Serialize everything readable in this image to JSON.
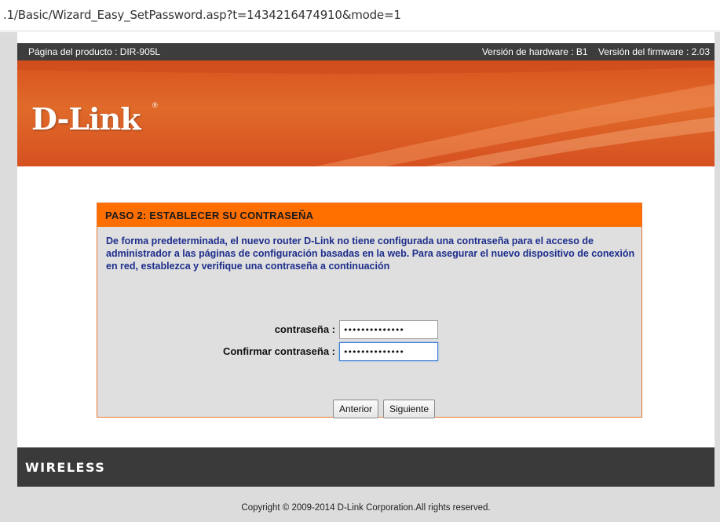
{
  "browser": {
    "url": ".1/Basic/Wizard_Easy_SetPassword.asp?t=1434216474910&mode=1"
  },
  "topbar": {
    "product_page": "Página del producto : DIR-905L",
    "hardware_version": "Versión de hardware : B1",
    "firmware_version": "Versión del firmware : 2.03"
  },
  "banner": {
    "logo": "D-Link",
    "logo_mark": "®"
  },
  "wizard": {
    "title": "PASO 2: ESTABLECER SU CONTRASEÑA",
    "description": "De forma predeterminada, el nuevo router D-Link no tiene configurada una contraseña para el acceso de administrador a las páginas de configuración basadas en la web. Para asegurar el nuevo dispositivo de conexión en red, establezca y verifique una contraseña a continuación",
    "password_label": "contraseña :",
    "password_value": "••••••••••••••",
    "confirm_label": "Confirmar contraseña :",
    "confirm_value": "••••••••••••••",
    "prev_button": "Anterior",
    "next_button": "Siguiente"
  },
  "footer": {
    "wireless": "WIRELESS",
    "copyright": "Copyright © 2009-2014 D-Link Corporation.All rights reserved."
  },
  "colors": {
    "banner_orange": "#d9531f",
    "wizard_header": "#ff6f00",
    "description_text": "#1e2e8c",
    "dark_bar": "#3d3d3d"
  }
}
